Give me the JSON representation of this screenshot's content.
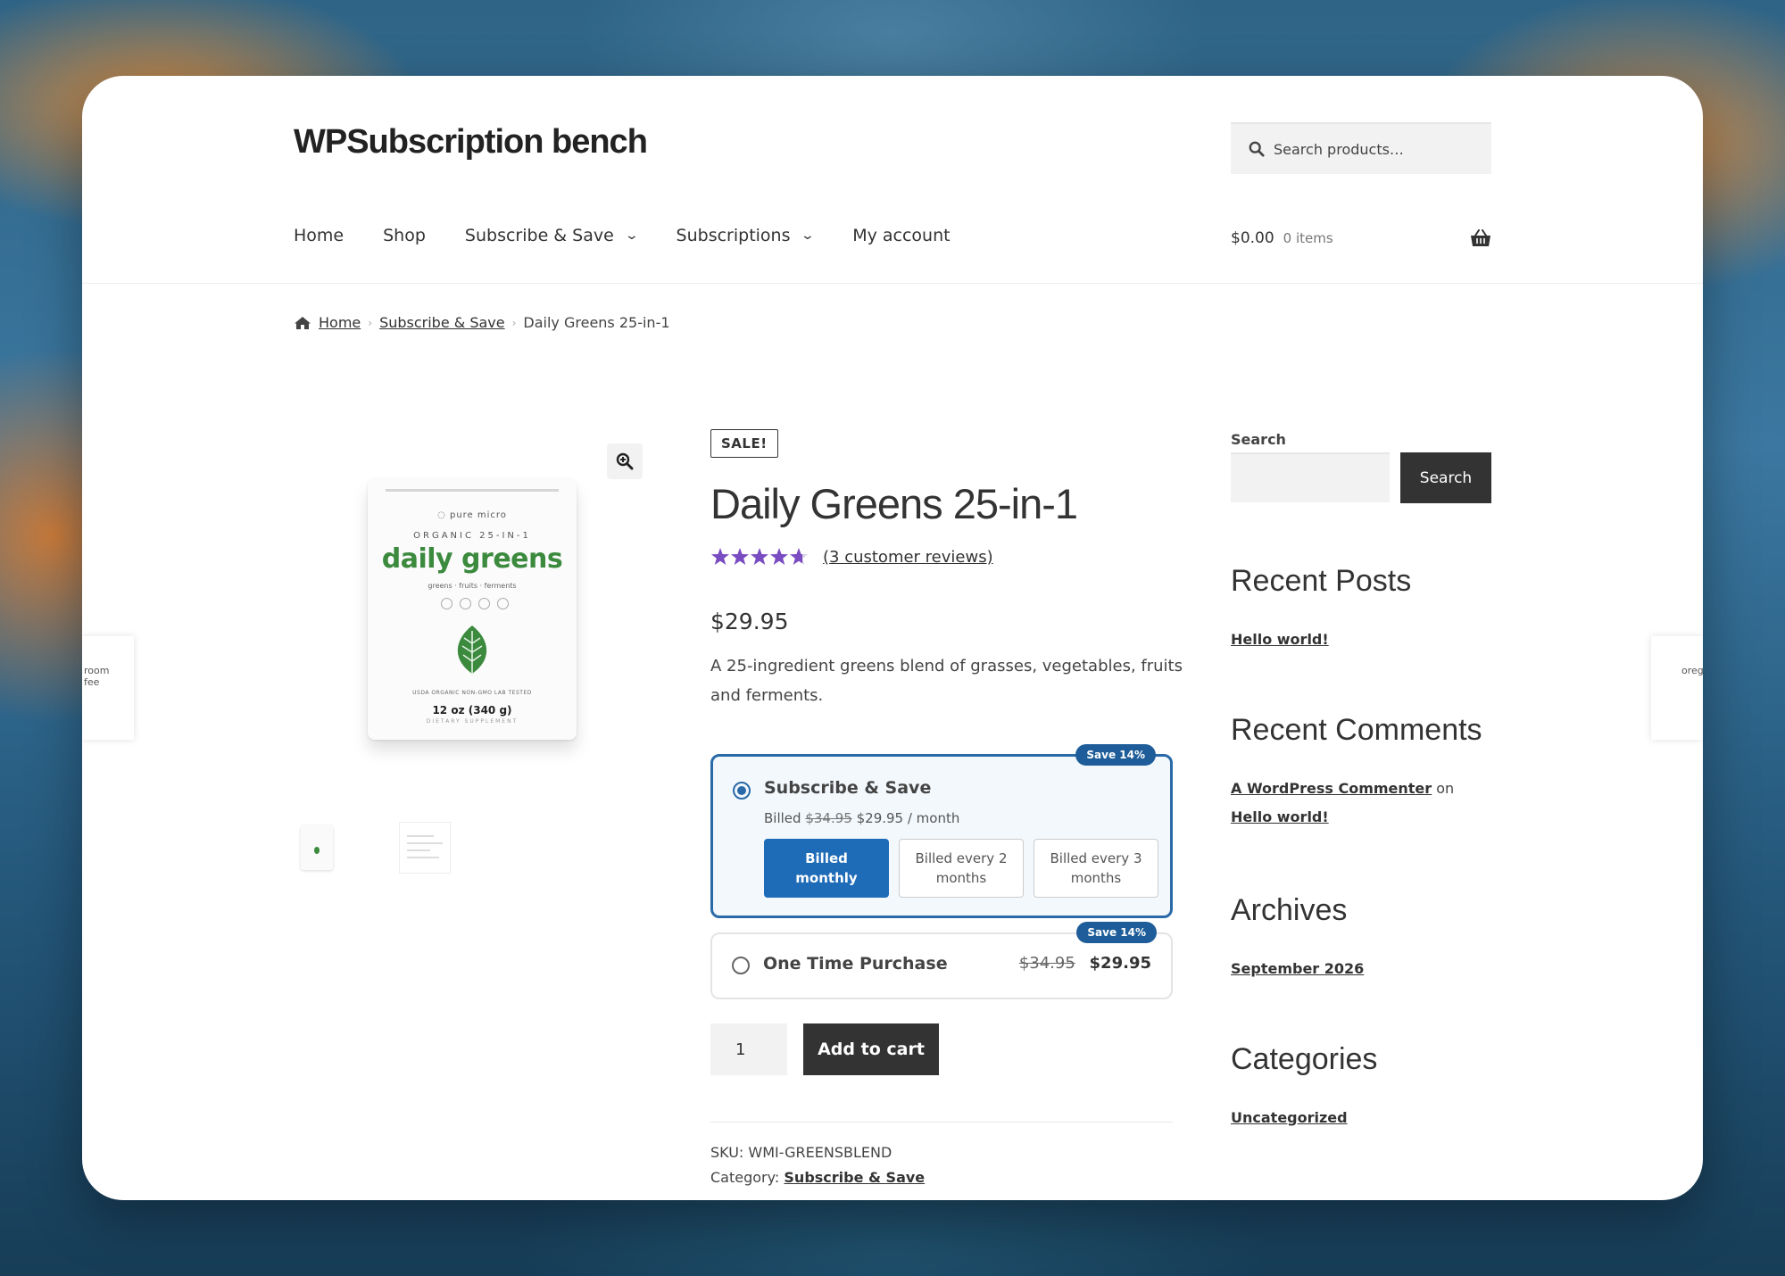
{
  "site": {
    "title": "WPSubscription bench"
  },
  "search": {
    "placeholder": "Search products…"
  },
  "nav": [
    {
      "label": "Home"
    },
    {
      "label": "Shop"
    },
    {
      "label": "Subscribe & Save",
      "has_dropdown": true
    },
    {
      "label": "Subscriptions",
      "has_dropdown": true
    },
    {
      "label": "My account"
    }
  ],
  "cart": {
    "amount": "$0.00",
    "items": "0 items",
    "icon": "basket-icon"
  },
  "breadcrumb": {
    "home": "Home",
    "category": "Subscribe & Save",
    "current": "Daily Greens 25-in-1"
  },
  "gallery": {
    "image": {
      "brand": "◌ pure micro",
      "line": "ORGANIC 25-IN-1",
      "name": "daily greens",
      "sub": "greens · fruits · ferments",
      "certs": "USDA ORGANIC    NON-GMO    LAB TESTED",
      "weight": "12 oz (340 g)",
      "supplement": "DIETARY SUPPLEMENT"
    },
    "prev_thumb_text": "room\nfee",
    "next_thumb_text": "orega"
  },
  "product": {
    "badge": "SALE!",
    "title": "Daily Greens 25-in-1",
    "rating": 4.7,
    "reviews_link": "(3 customer reviews)",
    "price": "$29.95",
    "description": "A 25-ingredient greens blend of grasses, vegetables, fruits and ferments.",
    "subscribe_option": {
      "label": "Subscribe & Save",
      "badge": "Save 14%",
      "billed_prefix": "Billed",
      "old_price": "$34.95",
      "new_price": "$29.95 / month",
      "selected": true,
      "frequencies": [
        {
          "label": "Billed monthly",
          "selected": true
        },
        {
          "label": "Billed every 2 months",
          "selected": false
        },
        {
          "label": "Billed every 3 months",
          "selected": false
        }
      ]
    },
    "one_time_option": {
      "label": "One Time Purchase",
      "badge": "Save 14%",
      "old_price": "$34.95",
      "price": "$29.95",
      "selected": false
    },
    "quantity": "1",
    "add_to_cart": "Add to cart",
    "sku_label": "SKU:",
    "sku": "WMI-GREENSBLEND",
    "category_label": "Category:",
    "category": "Subscribe & Save"
  },
  "sidebar": {
    "search_label": "Search",
    "search_button": "Search",
    "recent_posts_title": "Recent Posts",
    "recent_posts": [
      "Hello world!"
    ],
    "recent_comments_title": "Recent Comments",
    "comment_author": "A WordPress Commenter",
    "comment_on": "on",
    "comment_post": "Hello world!",
    "archives_title": "Archives",
    "archives": [
      "September 2026"
    ],
    "categories_title": "Categories",
    "categories": [
      "Uncategorized"
    ]
  },
  "colors": {
    "accent": "#1e6bb8",
    "badge": "#1e5d99",
    "star": "#7a4cc2",
    "button_dark": "#333333"
  }
}
